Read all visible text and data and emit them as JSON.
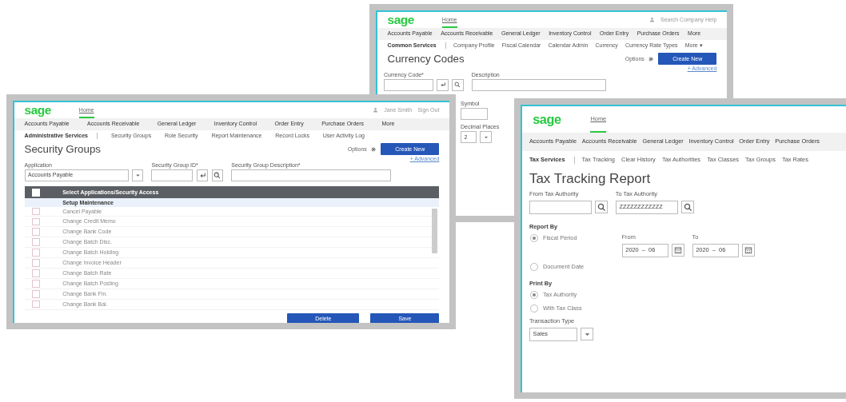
{
  "windows": [
    {
      "kind": "currency_codes",
      "logo": "sage",
      "home": {
        "label": "Home",
        "selected": true
      },
      "user": [
        "Search Company Help"
      ],
      "nav": [
        "Accounts Payable",
        "Accounts Receivable",
        "General Ledger",
        "Inventory Control",
        "Order Entry",
        "Purchase Orders",
        "More"
      ],
      "subnav": {
        "section": "Common Services",
        "links": [
          "Company Profile",
          "Fiscal Calendar",
          "Calendar Admin",
          "Currency",
          "Currency Rate Types",
          "More ▾"
        ]
      },
      "title": "Currency Codes",
      "options": "Options",
      "create": "Create New",
      "advanced": "+ Advanced",
      "fields": [
        {
          "label": "Currency Code*",
          "kind": "lookup"
        },
        {
          "label": "Description",
          "kind": "text"
        },
        {
          "label": "Symbol",
          "kind": "text"
        },
        {
          "label": "Decimal Places",
          "kind": "select",
          "value": "2"
        }
      ]
    },
    {
      "kind": "security_groups",
      "logo": "sage",
      "home": {
        "label": "Home",
        "selected": true
      },
      "user": [
        "Jane Smith",
        "Sign Out"
      ],
      "nav": [
        "Accounts Payable",
        "Accounts Receivable",
        "General Ledger",
        "Inventory Control",
        "Order Entry",
        "Purchase Orders",
        "More"
      ],
      "subnav": {
        "section": "Administrative Services",
        "links": [
          "Security Groups",
          "Role Security",
          "Report Maintenance",
          "Record Locks",
          "User Activity Log"
        ]
      },
      "title": "Security Groups",
      "options": "Options",
      "create": "Create New",
      "advanced": "+ Advanced",
      "fields": [
        {
          "label": "Application",
          "kind": "select",
          "value": "Accounts Payable"
        },
        {
          "label": "Security Group ID*",
          "kind": "lookup"
        },
        {
          "label": "Security Group Description*",
          "kind": "text"
        }
      ],
      "table": {
        "header": {
          "label": "Select Applications/Security Access",
          "checked": false
        },
        "group": "Setup Maintenance",
        "rows": [
          {
            "label": "Cancel Payable",
            "checked": false
          },
          {
            "label": "Change Credit Memo",
            "checked": false
          },
          {
            "label": "Change Bank Code",
            "checked": false
          },
          {
            "label": "Change Batch Disc.",
            "checked": false
          },
          {
            "label": "Change Batch Holding",
            "checked": false
          },
          {
            "label": "Change Invoice Header",
            "checked": false
          },
          {
            "label": "Change Batch Rate",
            "checked": false
          },
          {
            "label": "Change Batch Posting",
            "checked": false
          },
          {
            "label": "Change Bank Fin.",
            "checked": false
          },
          {
            "label": "Change Bank Bal.",
            "checked": false
          }
        ]
      },
      "buttons": [
        "Delete",
        "Save"
      ]
    },
    {
      "kind": "tax_report",
      "logo": "sage",
      "home": {
        "label": "Home",
        "selected": true
      },
      "nav": [
        "Accounts Payable",
        "Accounts Receivable",
        "General Ledger",
        "Inventory Control",
        "Order Entry",
        "Purchase Orders"
      ],
      "subnav": {
        "section": "Tax Services",
        "links": [
          "Tax Tracking",
          "Clear History",
          "Tax Authorities",
          "Tax Classes",
          "Tax Groups",
          "Tax Rates"
        ]
      },
      "title": "Tax Tracking Report",
      "fields": [
        {
          "label": "From Tax Authority",
          "kind": "lookup"
        },
        {
          "label": "To Tax Authority",
          "kind": "lookup",
          "value": "ZZZZZZZZZZZZ"
        }
      ],
      "report_by": {
        "title": "Report By",
        "options": [
          {
            "label": "Fiscal Period",
            "selected": true
          },
          {
            "label": "Document Date",
            "selected": false
          }
        ],
        "dates": [
          {
            "label": "From",
            "value": "2020  –  06"
          },
          {
            "label": "To",
            "value": "2020  –  06"
          }
        ]
      },
      "print_by": {
        "title": "Print By",
        "options": [
          {
            "label": "Tax Authority",
            "selected": true
          },
          {
            "label": "With Tax Class",
            "selected": false
          }
        ]
      },
      "transaction_type": {
        "label": "Transaction Type",
        "value": "Sales"
      }
    }
  ]
}
